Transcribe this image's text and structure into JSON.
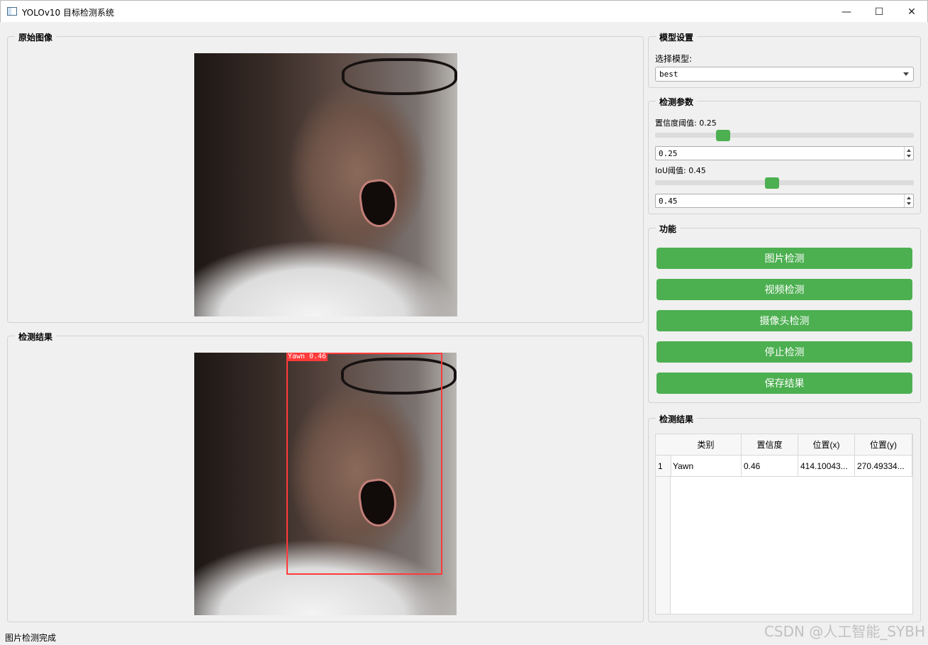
{
  "window": {
    "title": "YOLOv10 目标检测系统",
    "minimize_glyph": "—",
    "maximize_glyph": "☐",
    "close_glyph": "✕"
  },
  "original_panel": {
    "title": "原始图像"
  },
  "result_panel": {
    "title": "检测结果",
    "box_label": "Yawn 0.46"
  },
  "model_settings": {
    "title": "模型设置",
    "select_label": "选择模型:",
    "selected_model": "best"
  },
  "detect_params": {
    "title": "检测参数",
    "conf_label": "置信度阈值: 0.25",
    "conf_value": "0.25",
    "conf_fraction": 0.25,
    "iou_label": "IoU阈值: 0.45",
    "iou_value": "0.45",
    "iou_fraction": 0.45
  },
  "functions": {
    "title": "功能",
    "buttons": [
      "图片检测",
      "视频检测",
      "摄像头检测",
      "停止检测",
      "保存结果"
    ]
  },
  "results_table": {
    "title": "检测结果",
    "headers": [
      "类别",
      "置信度",
      "位置(x)",
      "位置(y)"
    ],
    "rows": [
      {
        "index": "1",
        "cells": [
          "Yawn",
          "0.46",
          "414.10043...",
          "270.49334..."
        ]
      }
    ]
  },
  "status_bar": {
    "text": "图片检测完成"
  },
  "watermark": {
    "text": "CSDN @人工智能_SYBH"
  },
  "colors": {
    "accent_green": "#4caf50",
    "detection_red": "#ff3b3b"
  }
}
